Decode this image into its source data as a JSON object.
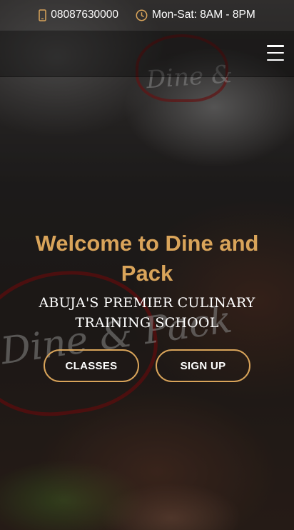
{
  "colors": {
    "accent": "#d9a45a",
    "text": "#ffffff"
  },
  "topbar": {
    "phone_icon": "phone-icon",
    "phone": "08087630000",
    "hours_icon": "clock-icon",
    "hours": "Mon-Sat: 8AM - 8PM"
  },
  "navbar": {
    "menu_icon": "hamburger-menu-icon"
  },
  "hero": {
    "title": "Welcome to Dine and Pack",
    "subtitle": "ABUJA'S PREMIER CULINARY TRAINING SCHOOL",
    "buttons": {
      "classes": "CLASSES",
      "signup": "SIGN UP"
    }
  }
}
